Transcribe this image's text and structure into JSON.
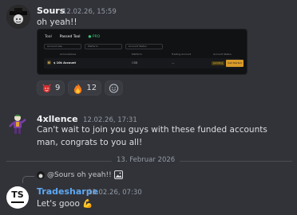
{
  "messages": [
    {
      "author": "Sours",
      "author_color": "#f2f3f5",
      "timestamp": "12.02.26, 15:59",
      "text": "oh yeah!!",
      "embed": {
        "tabs": [
          "Tool",
          "Passed Tool",
          "PRO"
        ],
        "filters": [
          "Account size",
          "Platform",
          "Account Status"
        ],
        "columns": [
          "Account/Area",
          "Platform",
          "Trading Account",
          "Account Status"
        ],
        "row": {
          "name": "$ 10k Account",
          "platform": "CBB",
          "account": "—",
          "status": "pending",
          "action": "Get Started"
        }
      },
      "reactions": [
        {
          "icon": "red-devil-icon",
          "count": "9"
        },
        {
          "icon": "fire-icon",
          "count": "12"
        },
        {
          "icon": "add-reaction-icon",
          "count": ""
        }
      ]
    },
    {
      "author": "4xllence",
      "author_color": "#f2f3f5",
      "timestamp": "12.02.26, 17:31",
      "text": "Can't wait to join you guys with these funded accounts man, congrats to you all!"
    },
    {
      "author": "Tradesharpe",
      "author_color": "#5ea8f2",
      "timestamp": "13.02.26, 07:30",
      "text": "Let's gooo 💪",
      "reply": {
        "mention": "@Sours",
        "text": "oh yeah!!",
        "icon": "image-icon"
      }
    }
  ],
  "date_divider": "13. Februar 2026",
  "avatar_initials": "TS"
}
